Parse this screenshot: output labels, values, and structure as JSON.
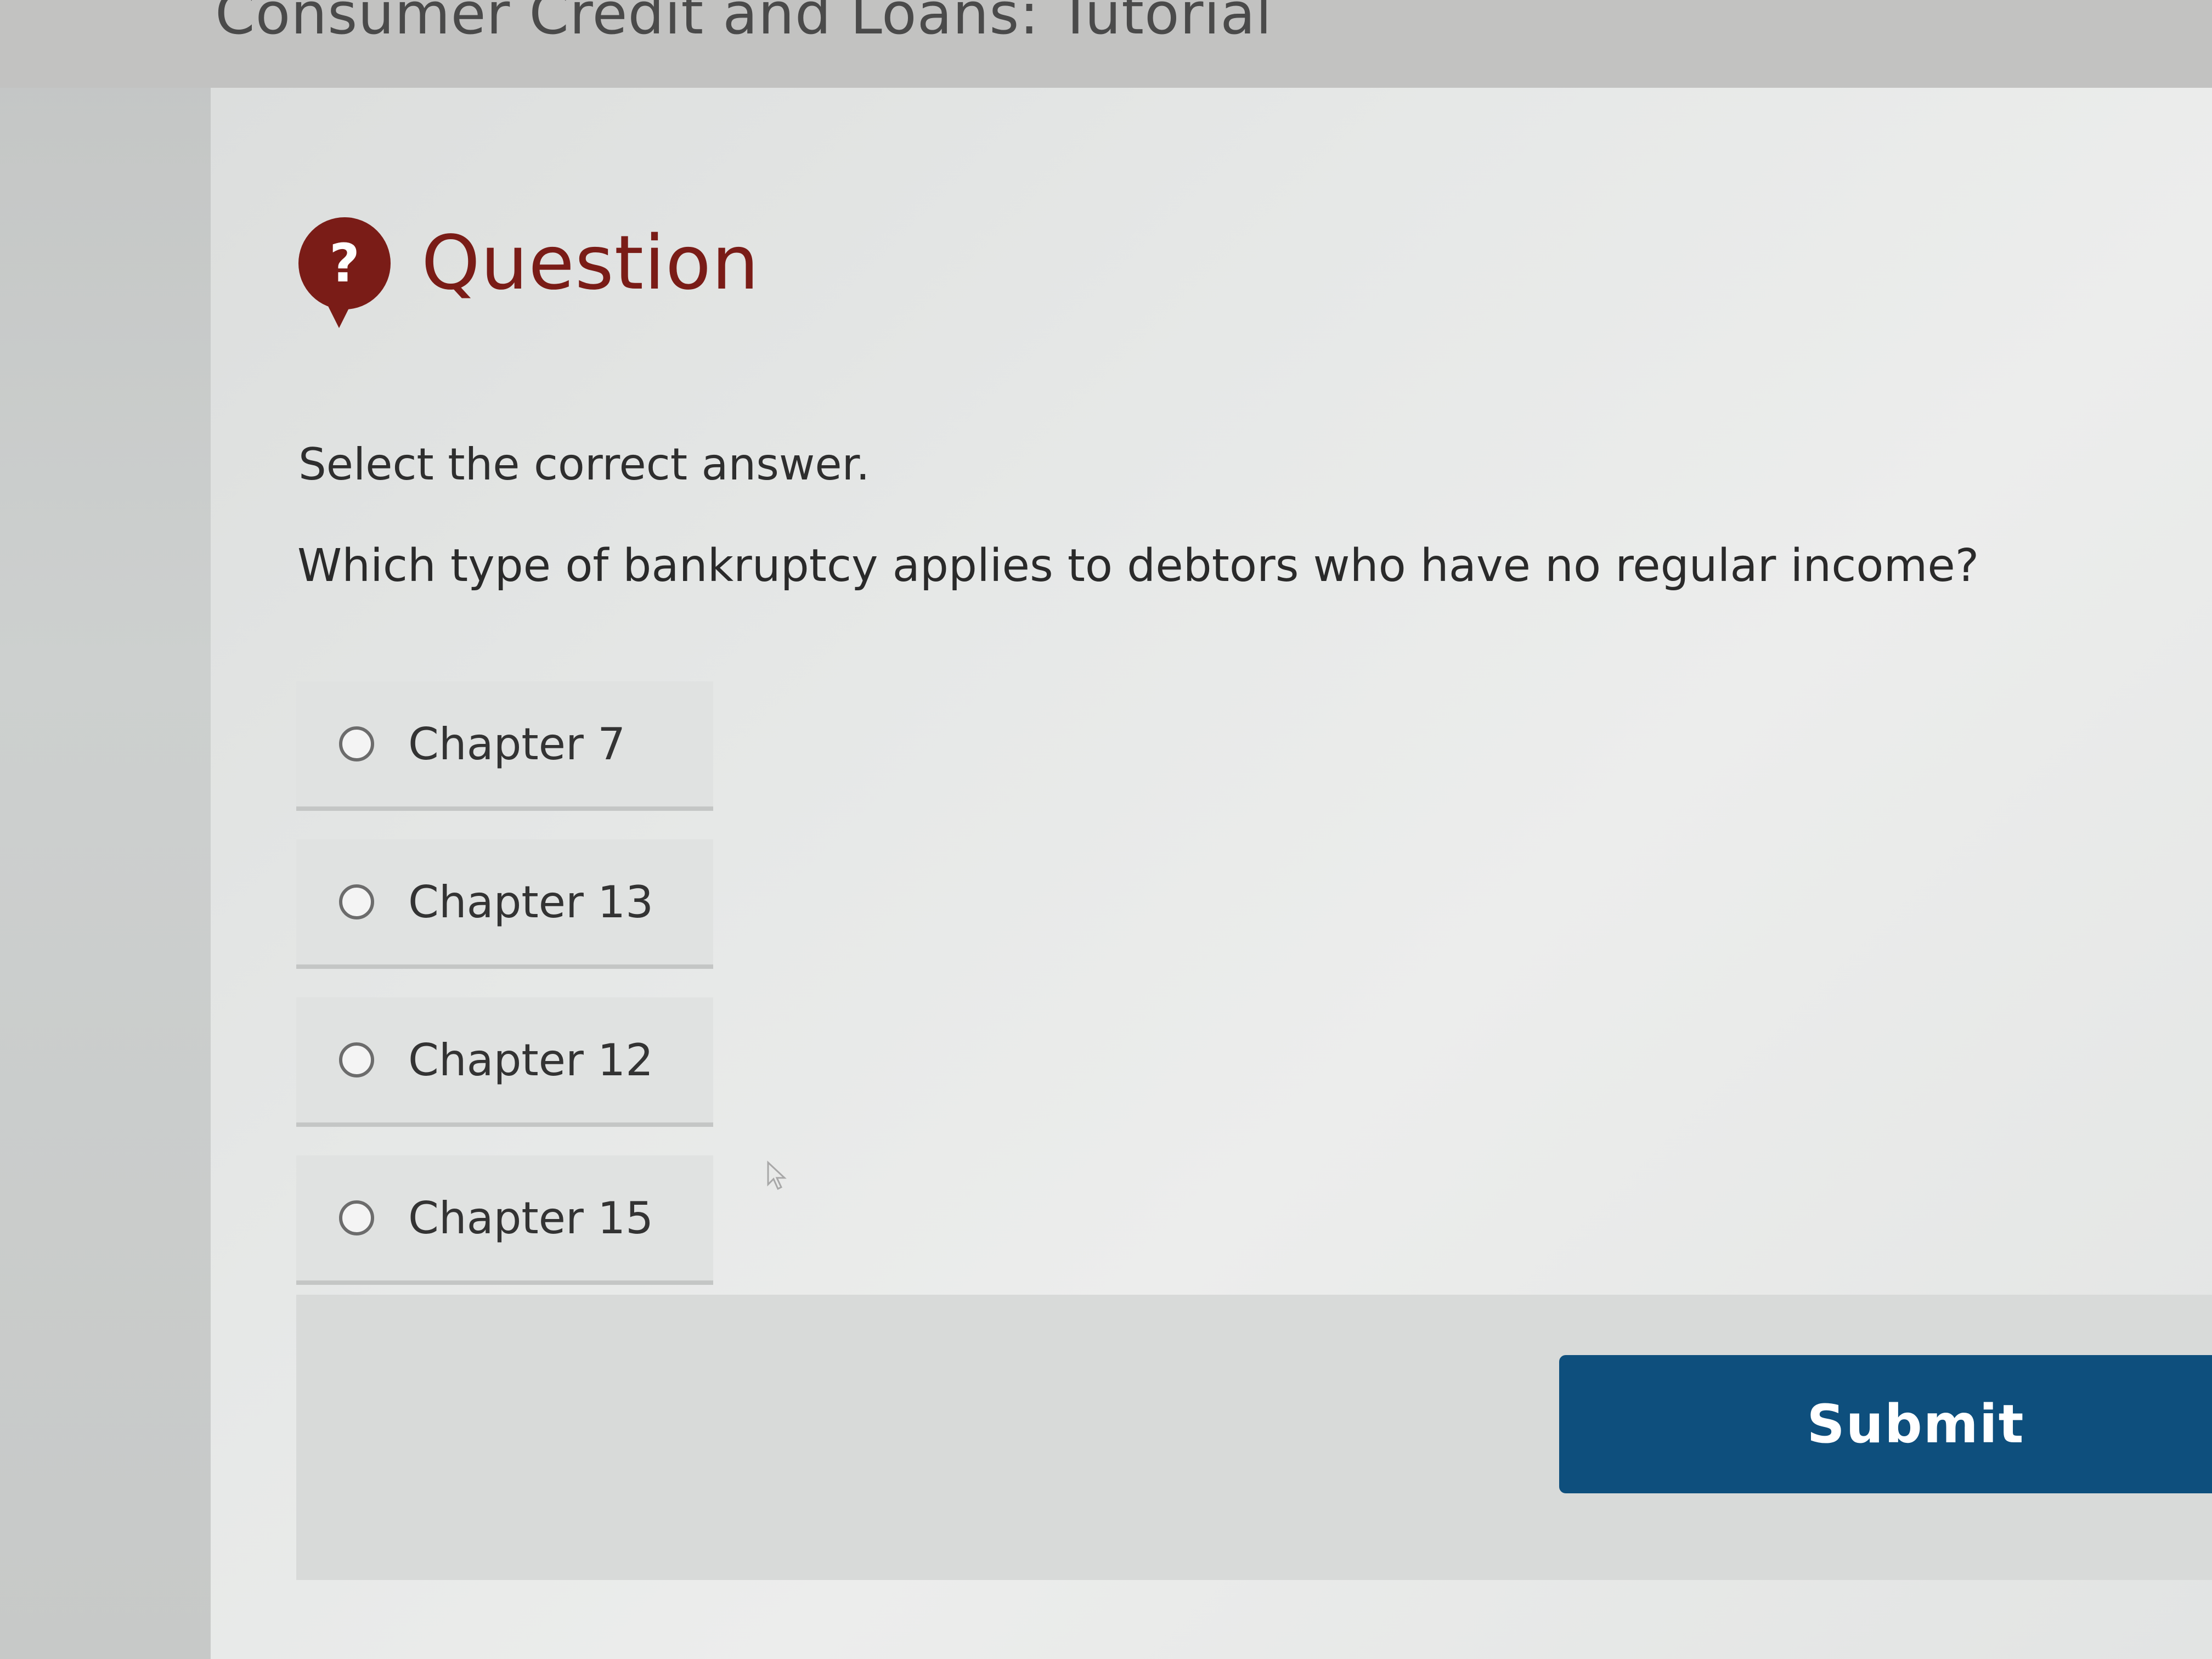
{
  "header": {
    "tutorial_title": "Consumer Credit and Loans: Tutorial"
  },
  "question": {
    "icon": "question-mark-icon",
    "icon_glyph": "?",
    "title": "Question",
    "instruction": "Select the correct answer.",
    "prompt": "Which type of bankruptcy applies to debtors who have no regular income?"
  },
  "options": [
    {
      "label": "Chapter 7",
      "selected": false
    },
    {
      "label": "Chapter 13",
      "selected": false
    },
    {
      "label": "Chapter 12",
      "selected": false
    },
    {
      "label": "Chapter 15",
      "selected": false
    }
  ],
  "footer": {
    "submit_label": "Submit"
  },
  "colors": {
    "accent": "#7a1c17",
    "button": "#0e4f7d"
  }
}
